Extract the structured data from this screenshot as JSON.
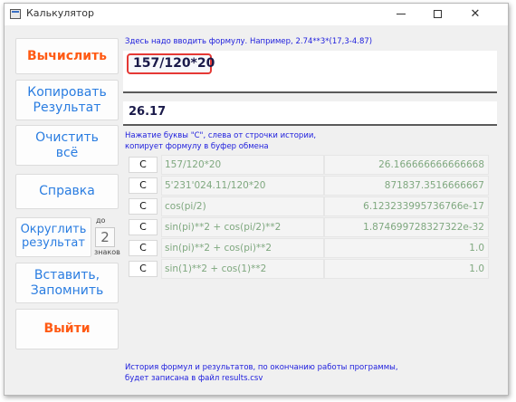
{
  "window": {
    "title": "Калькулятор",
    "icons": {
      "app": "calculator-app-icon",
      "minimize": "minimize-icon",
      "maximize": "maximize-icon",
      "close": "close-icon"
    },
    "close_glyph": "✕"
  },
  "buttons": {
    "calculate": "Вычислить",
    "copy_line1": "Копировать",
    "copy_line2": "Результат",
    "clear_line1": "Очистить",
    "clear_line2": "всё",
    "help": "Справка",
    "round_line1": "Округлить",
    "round_line2": "результат",
    "insert_line1": "Вставить,",
    "insert_line2": "Запомнить",
    "exit": "Выйти"
  },
  "rounding": {
    "label_before": "до",
    "value": "2",
    "label_after": "знаков"
  },
  "hint_formula": "Здесь надо вводить формулу. Например, 2.74**3*(17,3-4.87)",
  "formula_value": "157/120*20",
  "result_value": "26.17",
  "hint_history_line1": "Нажатие буквы \"С\", слева от строчки истории,",
  "hint_history_line2": "копирует формулу в буфер обмена",
  "history": [
    {
      "btn": "C",
      "formula": "157/120*20",
      "result": "26.166666666666668"
    },
    {
      "btn": "C",
      "formula": "5'231'024.11/120*20",
      "result": "871837.3516666667"
    },
    {
      "btn": "C",
      "formula": "cos(pi/2)",
      "result": "6.123233995736766e-17"
    },
    {
      "btn": "C",
      "formula": "sin(pi)**2 + cos(pi/2)**2",
      "result": "1.874699728327322e-32"
    },
    {
      "btn": "C",
      "formula": "sin(pi)**2 + cos(pi)**2",
      "result": "1.0"
    },
    {
      "btn": "C",
      "formula": "sin(1)**2 + cos(1)**2",
      "result": "1.0"
    }
  ],
  "footer_line1": "История формул и результатов, по окончанию работы программы,",
  "footer_line2": "будет записана в файл results.csv",
  "colors": {
    "accent_orange": "#ff5a14",
    "accent_blue": "#2a7de1",
    "hint_blue": "#1c1cdd",
    "formula_border": "#e53935",
    "history_text": "#7fa87f"
  }
}
